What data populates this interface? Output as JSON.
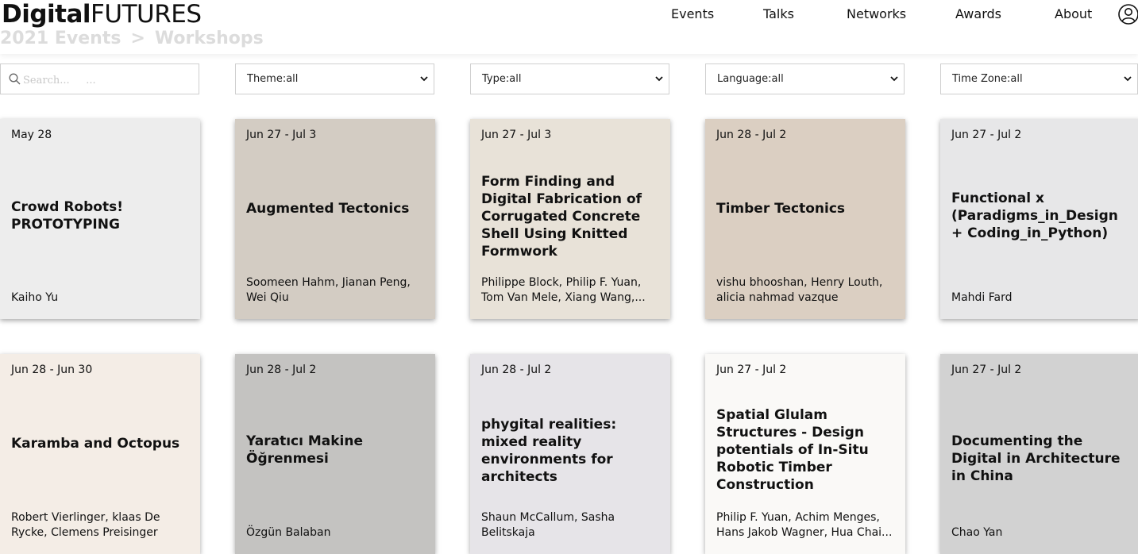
{
  "header": {
    "logo_bold": "Digital",
    "logo_light": "FUTURES",
    "breadcrumb": {
      "parent": "2021 Events",
      "separator": ">",
      "current": "Workshops"
    },
    "nav": [
      "Events",
      "Talks",
      "Networks",
      "Awards",
      "About"
    ],
    "user_icon": "user-circle-icon"
  },
  "filters": {
    "search_placeholder": "Search...     ...",
    "theme": "Theme:all",
    "type": "Type:all",
    "language": "Language:all",
    "timezone": "Time Zone:all"
  },
  "cards": [
    {
      "date": "May 28",
      "title": "Crowd Robots!\nPROTOTYPING",
      "authors": "Kaiho Yu",
      "bg": "#d8d8d8"
    },
    {
      "date": "Jun 27 - Jul 3",
      "title": "Augmented Tectonics",
      "authors": "Soomeen Hahm, Jianan Peng, Wei Qiu",
      "bg": "#9e8f7b"
    },
    {
      "date": "Jun 27 - Jul 3",
      "title": "Form Finding and Digital Fabrication of Corrugated Concrete Shell Using Knitted Formwork",
      "authors": "Philippe Block, Philip F. Yuan, Tom Van Mele, Xiang Wang,...",
      "bg": "#cdbfa8"
    },
    {
      "date": "Jun 28 - Jul 2",
      "title": "Timber Tectonics",
      "authors": "vishu bhooshan, Henry Louth, alicia nahmad vazque",
      "bg": "#b09478"
    },
    {
      "date": "Jun 27 - Jul 2",
      "title": "Functional x (Paradigms_in_Design + Coding_in_Python)",
      "authors": "Mahdi Fard",
      "bg": "#c9c9cc"
    },
    {
      "date": "Jun 28 - Jun 30",
      "title": "Karamba and Octopus",
      "authors": "Robert Vierlinger, klaas De Rycke, Clemens Preisinger",
      "bg": "#e6d7c8"
    },
    {
      "date": "Jun 28 - Jul 2",
      "title": "Yaratıcı Makine Öğrenmesi",
      "authors": "Özgün Balaban",
      "bg": "#7d7a76"
    },
    {
      "date": "Jun 28 - Jul 2",
      "title": "phygital realities: mixed reality environments for architects",
      "authors": "Shaun McCallum, Sasha Belitskaja",
      "bg": "#c8c4cc"
    },
    {
      "date": "Jun 27 - Jul 2",
      "title": "Spatial Glulam Structures - Design potentials of In-Situ Robotic Timber Construction",
      "authors": "Philip F. Yuan, Achim Menges, Hans Jakob Wagner, Hua Chai...",
      "bg": "#f4f2ee"
    },
    {
      "date": "Jun 27 - Jul 2",
      "title": "Documenting the Digital in Architecture in China",
      "authors": "Chao Yan",
      "bg": "#9c9c9c"
    }
  ]
}
